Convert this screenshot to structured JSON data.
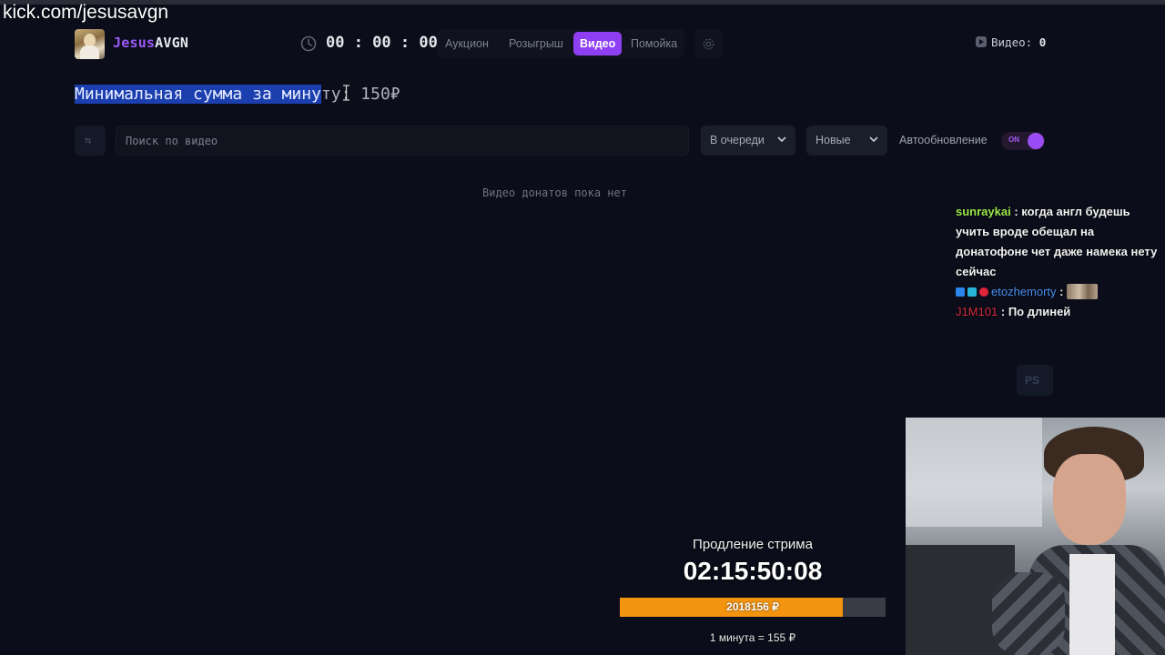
{
  "overlay": {
    "channel_url": "kick.com/jesusavgn"
  },
  "header": {
    "brand_part1": "Jesus",
    "brand_part2": "AVGN",
    "timer": "00 : 00 : 00",
    "nav": [
      {
        "label": "Аукцион",
        "active": false
      },
      {
        "label": "Розыгрыш",
        "active": false
      },
      {
        "label": "Видео",
        "active": true
      },
      {
        "label": "Помойка",
        "active": false
      }
    ],
    "settings_icon": "gear-icon",
    "video_count_label": "Видео:",
    "video_count_value": "0"
  },
  "min_sum": {
    "selected_text": "Минимальная сумма за мину",
    "rest_text": "ту: 150₽"
  },
  "toolbar": {
    "refresh_icon": "refresh-icon",
    "search_placeholder": "Поиск по видео",
    "search_value": "",
    "filter_status": "В очереди",
    "filter_sort": "Новые",
    "autoupdate_label": "Автообновление",
    "autoupdate_state": "ON"
  },
  "empty_state": "Видео донатов пока нет",
  "chat": [
    {
      "user": "sunraykai",
      "text": "когда англ будешь учить вроде обещал на донатофоне чет даже намека нету сейчас"
    },
    {
      "user": "etozhemorty",
      "text": ""
    },
    {
      "user": "J1M101",
      "text": "По длиней"
    }
  ],
  "stream_extend": {
    "title": "Продление стрима",
    "timer": "02:15:50:08",
    "amount": "2018156 ₽",
    "progress_fraction": 0.84,
    "rate": "1 минута = 155 ₽"
  },
  "colors": {
    "accent": "#8e3ff3",
    "selection": "#1b3fae",
    "progress": "#f29410",
    "background": "#0b0e1a"
  }
}
